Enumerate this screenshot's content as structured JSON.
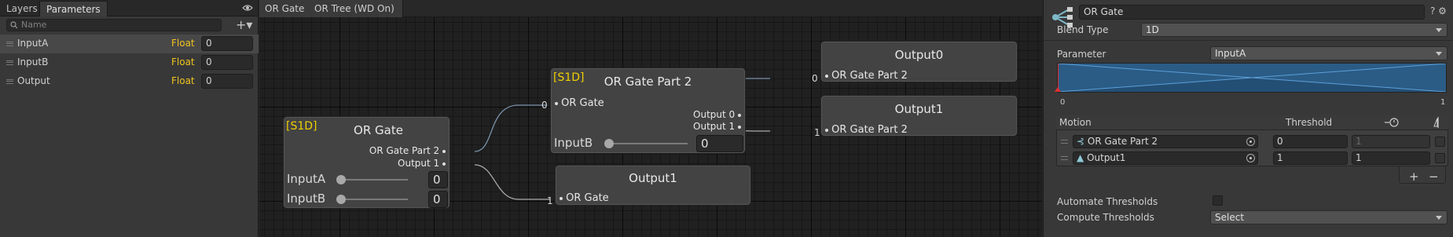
{
  "params_panel": {
    "tabs": [
      "Layers",
      "Parameters"
    ],
    "active_tab": "Parameters",
    "search_placeholder": "Name",
    "add_label": "+▾",
    "parameters": [
      {
        "name": "InputA",
        "type": "Float",
        "value": "0"
      },
      {
        "name": "InputB",
        "type": "Float",
        "value": "0"
      },
      {
        "name": "Output",
        "type": "Float",
        "value": "0"
      }
    ]
  },
  "breadcrumbs": [
    "OR Gate",
    "OR Tree (WD On)"
  ],
  "graph": {
    "nodes": {
      "or_gate": {
        "tag": "[S1D]",
        "title": "OR  Gate",
        "out_port_1": "OR Gate Part 2",
        "out_port_2": "Output 1",
        "input_a_label": "InputA",
        "input_a_value": "0",
        "input_b_label": "InputB",
        "input_b_value": "0"
      },
      "or_gate_part2": {
        "tag": "[S1D]",
        "title": "OR Gate Part 2",
        "in_port": "OR  Gate",
        "out_port_1": "Output 0",
        "out_port_2": "Output 1",
        "input_b_label": "InputB",
        "input_b_value": "0"
      },
      "output1_bottom": {
        "title": "Output1",
        "in_port": "OR  Gate"
      },
      "output0": {
        "title": "Output0",
        "in_port": "OR Gate Part 2"
      },
      "output1_right": {
        "title": "Output1",
        "in_port": "OR Gate Part 2"
      }
    },
    "link_labels": {
      "to_part2": "0",
      "to_output1_bottom": "1",
      "to_output0": "0",
      "to_output1_right": "1"
    }
  },
  "inspector": {
    "name": "OR  Gate",
    "header_icons": "? ⚙",
    "blend_type_label": "Blend Type",
    "blend_type": "1D",
    "parameter_label": "Parameter",
    "parameter": "InputA",
    "axis_min": "0",
    "axis_max": "1",
    "motion_header": "Motion",
    "threshold_header": "Threshold",
    "motions": [
      {
        "name": "OR Gate Part 2",
        "threshold": "0",
        "speed": "1",
        "speed_dim": true
      },
      {
        "name": "Output1",
        "threshold": "1",
        "speed": "1",
        "speed_dim": false
      }
    ],
    "plus": "+",
    "minus": "−",
    "automate_label": "Automate Thresholds",
    "compute_label": "Compute Thresholds",
    "compute_value": "Select",
    "colors": {
      "accent_blue": "#2b5c86",
      "param_type_yellow": "#f0c420",
      "node_tag_yellow": "#f0d000"
    }
  }
}
